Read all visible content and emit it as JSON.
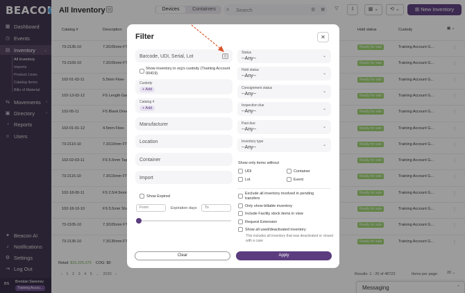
{
  "sidebar": {
    "logo": "BEACON",
    "logo_badge": "‹",
    "items": [
      {
        "label": "Dashboard",
        "icon": "dashboard-icon",
        "glyph": "▦"
      },
      {
        "label": "Events",
        "icon": "events-icon",
        "glyph": "◷"
      },
      {
        "label": "Inventory",
        "icon": "inventory-icon",
        "glyph": "▤"
      },
      {
        "label": "Movements",
        "icon": "movements-icon",
        "glyph": "⇆"
      },
      {
        "label": "Directory",
        "icon": "directory-icon",
        "glyph": "▣"
      },
      {
        "label": "Reports",
        "icon": "reports-icon",
        "glyph": "◔"
      },
      {
        "label": "Users",
        "icon": "users-icon",
        "glyph": "☺"
      }
    ],
    "inventory_sub": [
      "All Inventory",
      "Imports",
      "Product Lines",
      "Catalog Items",
      "Bills of Material"
    ],
    "bottom": [
      {
        "label": "Beacon AI",
        "icon": "beacon-ai-icon",
        "glyph": "✦"
      },
      {
        "label": "Notifications",
        "icon": "bell-icon",
        "glyph": "♪"
      },
      {
        "label": "Settings",
        "icon": "settings-icon",
        "glyph": "⚙"
      },
      {
        "label": "Log Out",
        "icon": "logout-icon",
        "glyph": "⇥"
      }
    ],
    "user": {
      "initials": "BS",
      "name": "Brendan Sweeney",
      "org": "Training Accou..."
    }
  },
  "header": {
    "title": "All Inventory",
    "tabs": [
      "Devices",
      "Containers"
    ],
    "search_placeholder": "Search",
    "new_button": "New Inventory"
  },
  "table": {
    "headers": [
      "Catalog #",
      "Description",
      "Hold status",
      "Custody"
    ],
    "rows": [
      {
        "catalog": "73-2135-10",
        "desc": "7.3/105mm FT"
      },
      {
        "catalog": "73-2100-10",
        "desc": "7.3/105mm FT"
      },
      {
        "catalog": "102-01-02-11",
        "desc": "5.5mm Flow-"
      },
      {
        "catalog": "102-13-02-12",
        "desc": "FS Length Gau"
      },
      {
        "catalog": "102-05-11",
        "desc": "FS Blank Driver"
      },
      {
        "catalog": "102-01-01-12",
        "desc": "4.5mm Flow-"
      },
      {
        "catalog": "73-2110-10",
        "desc": "7.3/110mm FT F"
      },
      {
        "catalog": "102-02-03-11",
        "desc": "FS 5.5mm Tap"
      },
      {
        "catalog": "73-2115-10",
        "desc": "7.3/115mm FT F"
      },
      {
        "catalog": "102-18-00-11",
        "desc": "FS 2.5/4.5mm"
      },
      {
        "catalog": "102-18-10-10",
        "desc": "FS 5.5mm Shal"
      },
      {
        "catalog": "73-2105-10",
        "desc": "7.3/105mm FT F"
      },
      {
        "catalog": "73-2135-10",
        "desc": "7.3/135mm FT F"
      }
    ],
    "hold_status": "Ready for sale",
    "custody": "Training Account G...",
    "kebab": "⋮"
  },
  "footer": {
    "retail_label": "Retail:",
    "retail_value": "$16,225,375",
    "cog_label": "COG:",
    "cog_value": "$0",
    "pages": [
      "‹",
      "1",
      "2",
      "3",
      "4",
      "5",
      "...",
      "2033",
      "›"
    ],
    "results": "Results: 1 - 20 of 48723",
    "rows_per_page_label": "Items per page:",
    "rows_per_page": "20"
  },
  "messaging": {
    "title": "Messaging",
    "chevron": "⌃"
  },
  "filter": {
    "title": "Filter",
    "close": "✕",
    "barcode_placeholder": "Barcode, UDI, Serial, Lot",
    "show_custody_label": "Show inventory in org's custody (Training Account 00419)",
    "custody_label": "Custody",
    "catalog_label": "Catalog #",
    "add_label": "+ Add",
    "manufacturer_placeholder": "Manufacturer",
    "location_placeholder": "Location",
    "container_placeholder": "Container",
    "import_placeholder": "Import",
    "show_expired_label": "Show Expired",
    "from_placeholder": "From",
    "expiration_days_label": "Expiration days",
    "to_placeholder": "To",
    "dropdowns": [
      {
        "label": "Status",
        "value": "--Any--"
      },
      {
        "label": "Hold status",
        "value": "--Any--"
      },
      {
        "label": "Consignment status",
        "value": "--Any--"
      },
      {
        "label": "Inspection due",
        "value": "--Any--"
      },
      {
        "label": "Past due",
        "value": "--Any--"
      },
      {
        "label": "Inventory type",
        "value": "--Any--"
      }
    ],
    "without_label": "Show only items without",
    "without_items": [
      "UDI",
      "Container",
      "Lot",
      "Event"
    ],
    "options": [
      "Exclude all inventory involved in pending transfers",
      "Only show billable inventory",
      "Include Facility stock items in view",
      "Request Extension",
      "Show all used/deactivated inventory"
    ],
    "note": "This includes all inventory that was deactivated or closed with a case",
    "clear_label": "Clear",
    "apply_label": "Apply"
  },
  "colors": {
    "brand": "#5b3c7e",
    "sidebar": "#3a2e49",
    "ready_badge": "#9cd56c",
    "arrow": "#d9542b"
  }
}
